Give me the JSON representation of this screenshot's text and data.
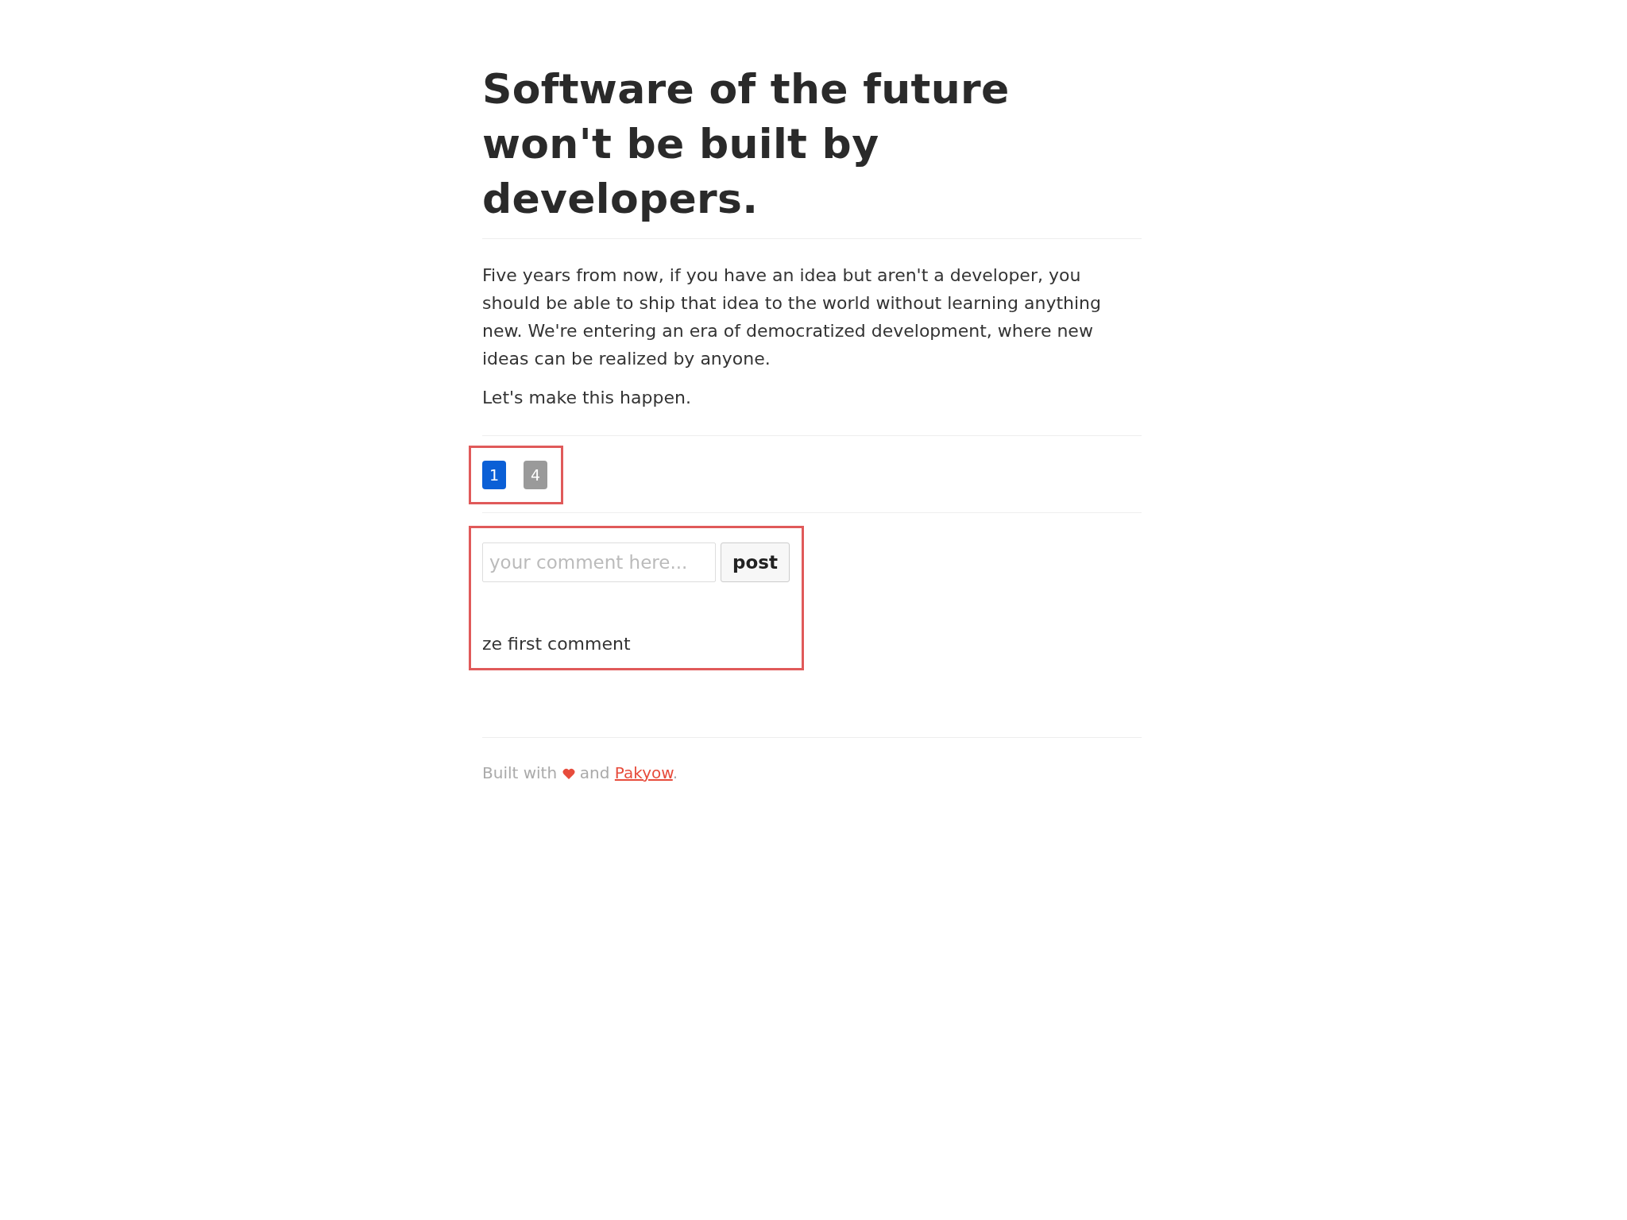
{
  "title": "Software of the future won't be built by developers.",
  "paragraphs": [
    "Five years from now, if you have an idea but aren't a developer, you should be able to ship that idea to the world without learning anything new. We're entering an era of democratized development, where new ideas can be realized by anyone.",
    "Let's make this happen."
  ],
  "votes": [
    {
      "count": "1",
      "selected": true
    },
    {
      "count": "4",
      "selected": false
    }
  ],
  "comment_form": {
    "placeholder": "your comment here...",
    "button": "post"
  },
  "comments": [
    "ze first comment"
  ],
  "footer": {
    "before": "Built with",
    "middle": "and",
    "link": "Pakyow",
    "after": "."
  }
}
